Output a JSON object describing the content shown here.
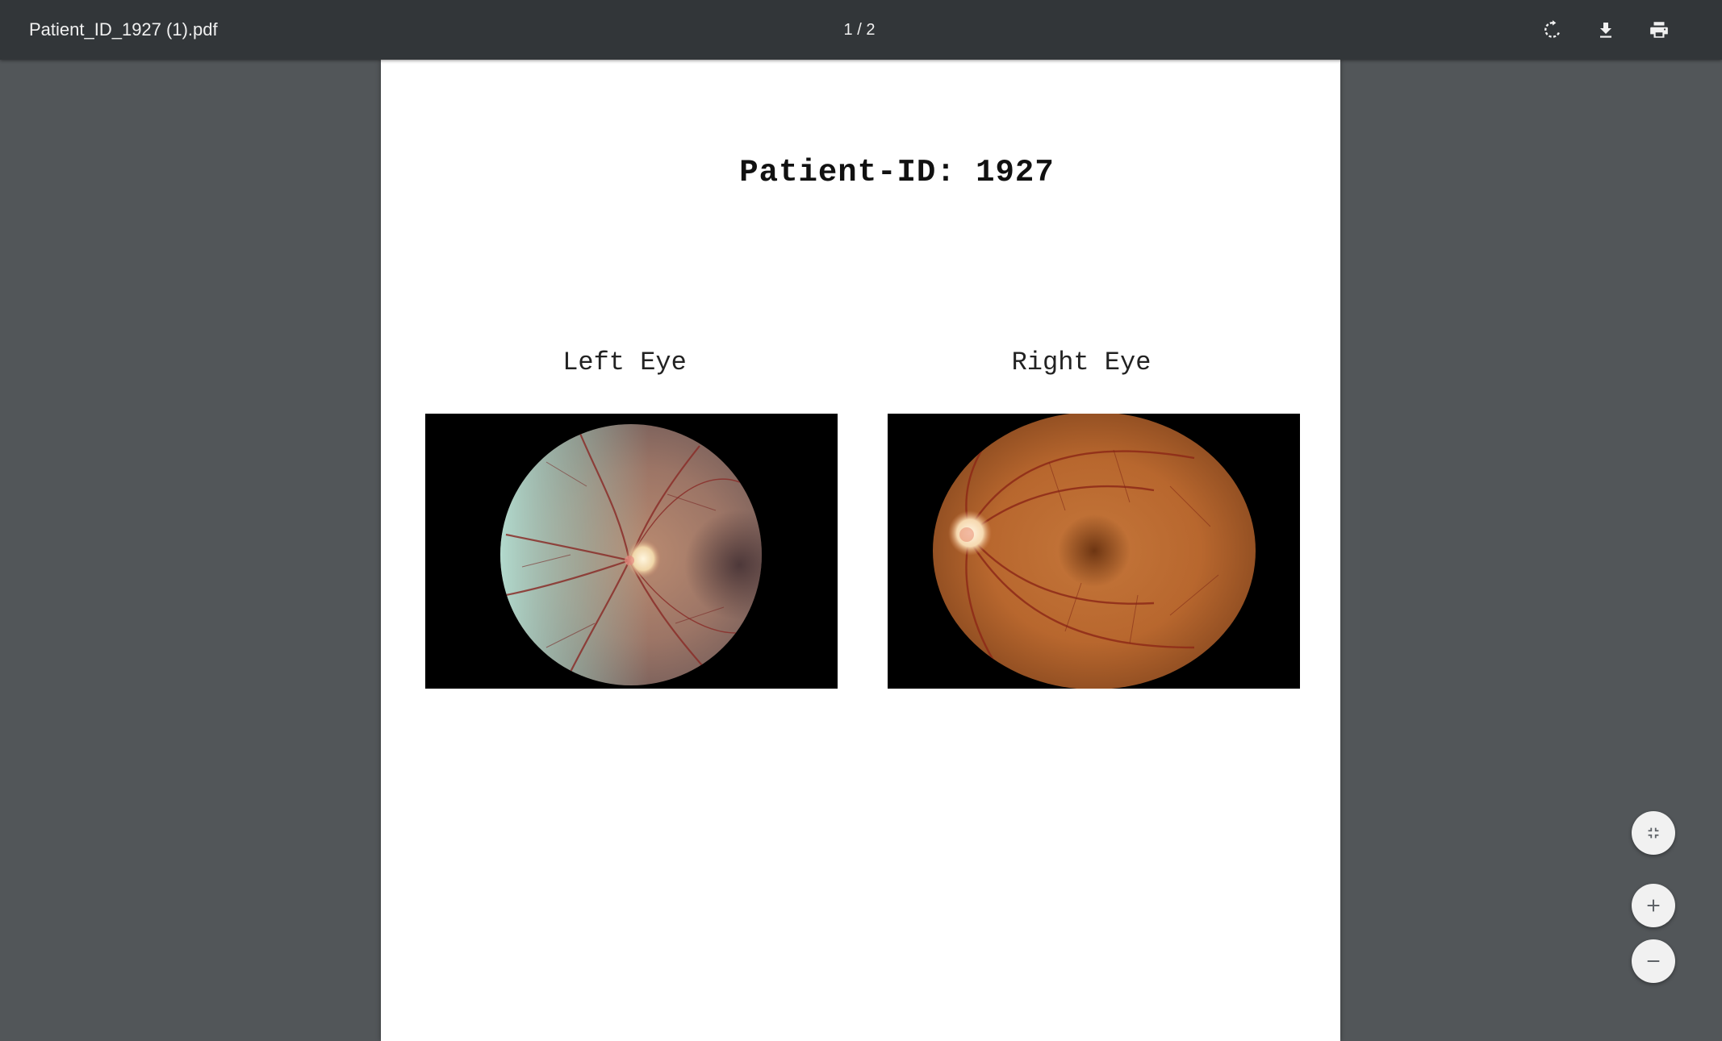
{
  "toolbar": {
    "document_title": "Patient_ID_1927 (1).pdf",
    "page_indicator": "1 / 2",
    "actions": {
      "rotate": "rotate-icon",
      "download": "download-icon",
      "print": "print-icon"
    }
  },
  "page": {
    "heading": "Patient-ID: 1927",
    "left_caption": "Left Eye",
    "right_caption": "Right Eye"
  },
  "zoom_controls": {
    "fit": "fit-to-page-icon",
    "zoom_in": "plus-icon",
    "zoom_out": "minus-icon"
  },
  "colors": {
    "toolbar_bg": "#323639",
    "viewer_bg": "#525659",
    "page_bg": "#ffffff"
  }
}
